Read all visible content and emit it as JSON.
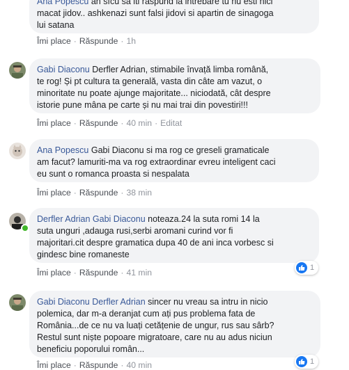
{
  "actions": {
    "like": "Îmi place",
    "reply": "Răspunde",
    "edited": "Editat",
    "separator": "·"
  },
  "comments": [
    {
      "author": "Ana Popescu",
      "text_line1": "an sfcu sa iti raspund la intrebare tu nu esti nici",
      "text_line2": "macat jidov.. ashkenazi sunt falsi jidovi si apartin de sinagoga",
      "text_line3": "lui satana",
      "time": "1h"
    },
    {
      "author": "Gabi Diaconu",
      "text_line1": "Derfler Adrian, stimabile învață limba română,",
      "text_line2": "te rog! Și pt cultura ta generală, vasta din câte am vazut, o",
      "text_line3": "minoritate nu poate ajunge majoritate... niciodată, cât despre",
      "text_line4": "istorie pune mâna pe carte și nu mai trai din povestiri!!!",
      "time": "40 min"
    },
    {
      "author": "Ana Popescu",
      "text_line1": "Gabi Diaconu si ma rog ce greseli gramaticale",
      "text_line2": "am facut? lamuriti-ma va rog extraordinar evreu inteligent caci",
      "text_line3": "eu sunt o romanca proasta si nespalata",
      "time": "38 min"
    },
    {
      "author": "Derfler Adrian",
      "tag": "Gabi Diaconu",
      "text_line1": "noteaza.24 la suta romi 14 la",
      "text_line2": "suta unguri ,adauga rusi,serbi aromani curind vor fi",
      "text_line3": "majoritari.cit despre gramatica dupa 40 de ani inca vorbesc si",
      "text_line4": "gindesc bine romaneste",
      "time": "41 min",
      "reactions": "1"
    },
    {
      "author": "Gabi Diaconu",
      "tag": "Derfler Adrian",
      "text_line1": "sincer nu vreau sa intru in nicio",
      "text_line2": "polemica, dar m-a deranjat cum ați pus problema fata de",
      "text_line3": "România...de ce nu va luați cetățenie de ungur, rus sau sârb?",
      "text_line4": "Restul sunt niște popoare migratoare, care nu au adus niciun",
      "text_line5": "beneficiu poporului român...",
      "time": "40 min",
      "reactions": "1"
    }
  ],
  "colors": {
    "link": "#385898",
    "bubble": "#f2f3f5",
    "like_blue": "#1877f2",
    "online": "#42b72a"
  }
}
